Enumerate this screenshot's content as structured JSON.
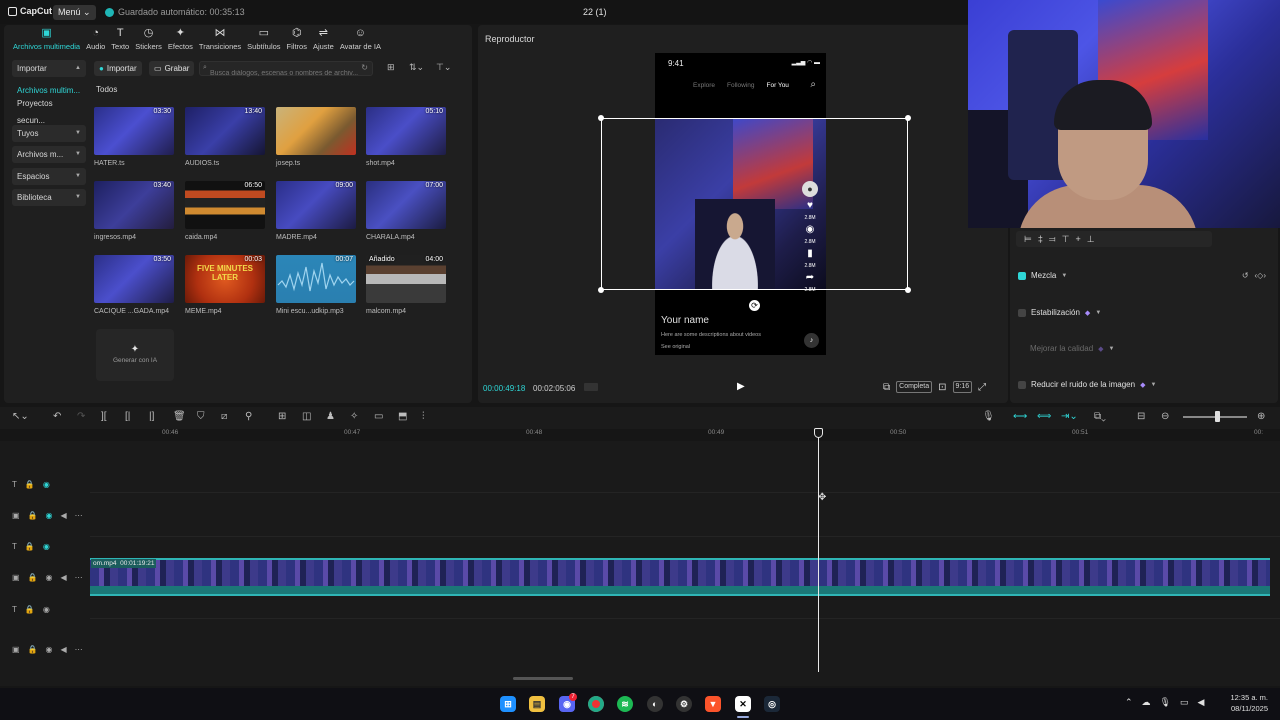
{
  "app": {
    "logo": "CapCut",
    "menu": "Menú",
    "autosave": "Guardado automático: 00:35:13",
    "project_title": "22 (1)"
  },
  "media_tabs": [
    {
      "label": "Archivos multimedia",
      "icon": "media-icon",
      "active": true
    },
    {
      "label": "Audio",
      "icon": "audio-icon"
    },
    {
      "label": "Texto",
      "icon": "text-icon"
    },
    {
      "label": "Stickers",
      "icon": "sticker-icon"
    },
    {
      "label": "Efectos",
      "icon": "effects-icon"
    },
    {
      "label": "Transiciones",
      "icon": "transitions-icon"
    },
    {
      "label": "Subtítulos",
      "icon": "subtitles-icon"
    },
    {
      "label": "Filtros",
      "icon": "filters-icon"
    },
    {
      "label": "Ajuste",
      "icon": "adjust-icon"
    },
    {
      "label": "Avatar de IA",
      "icon": "avatar-icon"
    }
  ],
  "sidebar": [
    {
      "label": "Importar",
      "chevron": true
    },
    {
      "label": "Archivos multim...",
      "active": true
    },
    {
      "label": "Proyectos secun..."
    },
    {
      "label": "Tuyos",
      "chevron": true
    },
    {
      "label": "Archivos m...",
      "chevron": true
    },
    {
      "label": "Espacios",
      "chevron": true
    },
    {
      "label": "Biblioteca",
      "chevron": true
    }
  ],
  "toolbar": {
    "import": "Importar",
    "record": "Grabar",
    "search_placeholder": "Busca diálogos, escenas o nombres de archiv..."
  },
  "section_label": "Todos",
  "media": [
    {
      "name": "HATER.ts",
      "duration": "03:30"
    },
    {
      "name": "AUDIOS.ts",
      "duration": "13:40"
    },
    {
      "name": "josep.ts",
      "duration": ""
    },
    {
      "name": "shot.mp4",
      "duration": "05:10"
    },
    {
      "name": "ingresos.mp4",
      "duration": "03:40"
    },
    {
      "name": "caida.mp4",
      "duration": "06:50"
    },
    {
      "name": "MADRE.mp4",
      "duration": "09:00"
    },
    {
      "name": "CHARALA.mp4",
      "duration": "07:00"
    },
    {
      "name": "CACIQUE ...GADA.mp4",
      "duration": "03:50"
    },
    {
      "name": "MEME.mp4",
      "duration": "00:03"
    },
    {
      "name": "Mini escu...udkip.mp3",
      "duration": "00:07"
    },
    {
      "name": "malcom.mp4",
      "duration": "04:00",
      "added": "Añadido"
    }
  ],
  "meme_text": "FIVE MINUTES LATER",
  "generate_ai": "Generar con IA",
  "player": {
    "title": "Reproductor",
    "current": "00:00:49:18",
    "total": "00:02:05:06",
    "fit": "Completa",
    "ratio": "9:16",
    "phone": {
      "time": "9:41",
      "nav": [
        "Explore",
        "Following",
        "For You"
      ],
      "likes": "2.8M",
      "comments": "2.8M",
      "saves": "2.8M",
      "shares": "2.8M",
      "name": "Your name",
      "desc": "Here are some descriptions about videos",
      "orig": "See original"
    }
  },
  "props": {
    "mix": "Mezcla",
    "stab": "Estabilización",
    "quality": "Mejorar la calidad",
    "noise": "Reducir el ruido de la imagen"
  },
  "timeline": {
    "ruler": [
      "00:46",
      "00:47",
      "00:48",
      "00:49",
      "00:50",
      "00:51",
      "00:"
    ],
    "clip_name": "om.mp4",
    "clip_duration": "00:01:19:21"
  },
  "clock": {
    "time": "12:35 a. m.",
    "date": "08/11/2025"
  },
  "discord_badge": "7",
  "colors": {
    "accent": "#2fd6d6",
    "panel": "#1f1f1f",
    "background": "#161616"
  }
}
